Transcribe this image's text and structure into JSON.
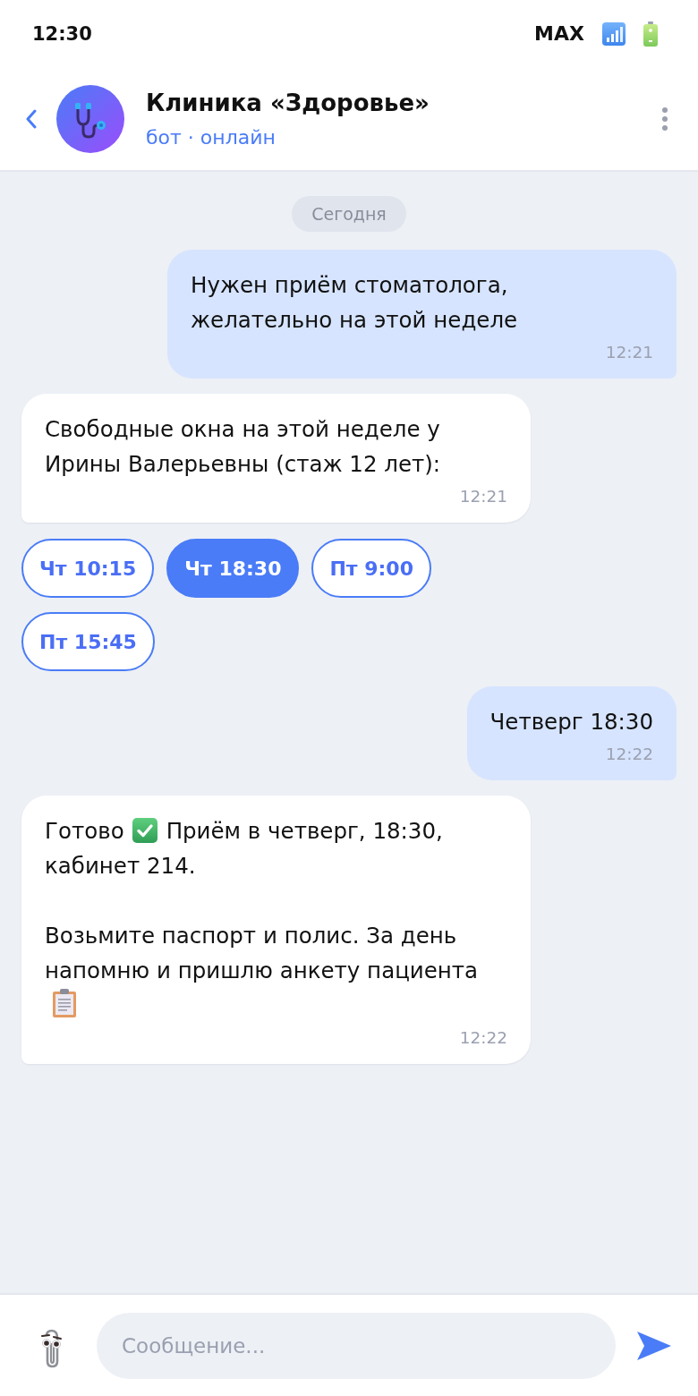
{
  "status_bar": {
    "time": "12:30",
    "carrier": "MAX"
  },
  "header": {
    "title": "Клиника «Здоровье»",
    "subtitle": "бот · онлайн"
  },
  "date_separator": "Сегодня",
  "messages": [
    {
      "kind": "outgoing",
      "text": "Нужен приём стоматолога, желательно на этой неделе",
      "time": "12:21"
    },
    {
      "kind": "incoming",
      "text": "Свободные окна на этой неделе у Ирины Валерьевны (стаж 12 лет):",
      "time": "12:21"
    },
    {
      "kind": "quick_replies",
      "options": [
        {
          "label": "Чт 10:15",
          "selected": false
        },
        {
          "label": "Чт 18:30",
          "selected": true
        },
        {
          "label": "Пт 9:00",
          "selected": false
        },
        {
          "label": "Пт 15:45",
          "selected": false
        }
      ]
    },
    {
      "kind": "outgoing",
      "text": "Четверг 18:30",
      "time": "12:22"
    },
    {
      "kind": "incoming",
      "paragraphs": [
        [
          {
            "kind": "text",
            "text": "Готово"
          },
          {
            "kind": "check_emoji"
          },
          {
            "kind": "text",
            "text": "Приём в четверг, 18:30,"
          },
          {
            "kind": "line_break"
          },
          {
            "kind": "text",
            "text": "кабинет 214."
          }
        ],
        [
          {
            "kind": "text",
            "text": "Возьмите паспорт и полис. За день напомню и пришлю анкету пациента"
          },
          {
            "kind": "clipboard_emoji"
          }
        ]
      ],
      "time": "12:22"
    }
  ],
  "composer": {
    "placeholder": "Сообщение..."
  }
}
